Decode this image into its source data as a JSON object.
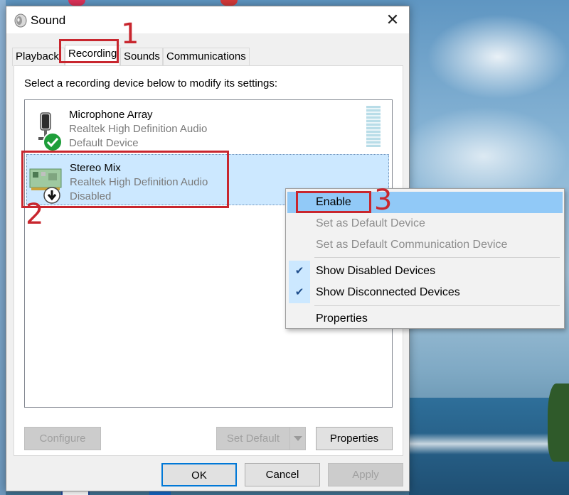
{
  "window": {
    "title": "Sound",
    "close_glyph": "✕"
  },
  "tabs": [
    {
      "label": "Playback",
      "active": false
    },
    {
      "label": "Recording",
      "active": true
    },
    {
      "label": "Sounds",
      "active": false
    },
    {
      "label": "Communications",
      "active": false
    }
  ],
  "recording": {
    "instruction": "Select a recording device below to modify its settings:",
    "devices": [
      {
        "name": "Microphone Array",
        "driver": "Realtek High Definition Audio",
        "status": "Default Device",
        "icon": "microphone-icon",
        "badge": "green-check-icon",
        "selected": false
      },
      {
        "name": "Stereo Mix",
        "driver": "Realtek High Definition Audio",
        "status": "Disabled",
        "icon": "sound-card-icon",
        "badge": "disabled-arrow-icon",
        "selected": true
      }
    ],
    "buttons": {
      "configure": "Configure",
      "set_default": "Set Default",
      "properties": "Properties"
    }
  },
  "dialog_buttons": {
    "ok": "OK",
    "cancel": "Cancel",
    "apply": "Apply"
  },
  "context_menu": {
    "items": [
      {
        "label": "Enable",
        "highlighted": true,
        "disabled": false,
        "checked": false
      },
      {
        "label": "Set as Default Device",
        "highlighted": false,
        "disabled": true,
        "checked": false
      },
      {
        "label": "Set as Default Communication Device",
        "highlighted": false,
        "disabled": true,
        "checked": false
      },
      {
        "label": "Show Disabled Devices",
        "highlighted": false,
        "disabled": false,
        "checked": true
      },
      {
        "label": "Show Disconnected Devices",
        "highlighted": false,
        "disabled": false,
        "checked": true
      },
      {
        "label": "Properties",
        "highlighted": false,
        "disabled": false,
        "checked": false
      }
    ]
  },
  "annotations": {
    "step1": "1",
    "step2": "2",
    "step3": "3",
    "color": "#c8262e"
  },
  "colors": {
    "selection": "#cce8ff",
    "menu_highlight": "#91c9f7",
    "check_green": "#1e9e3a"
  }
}
